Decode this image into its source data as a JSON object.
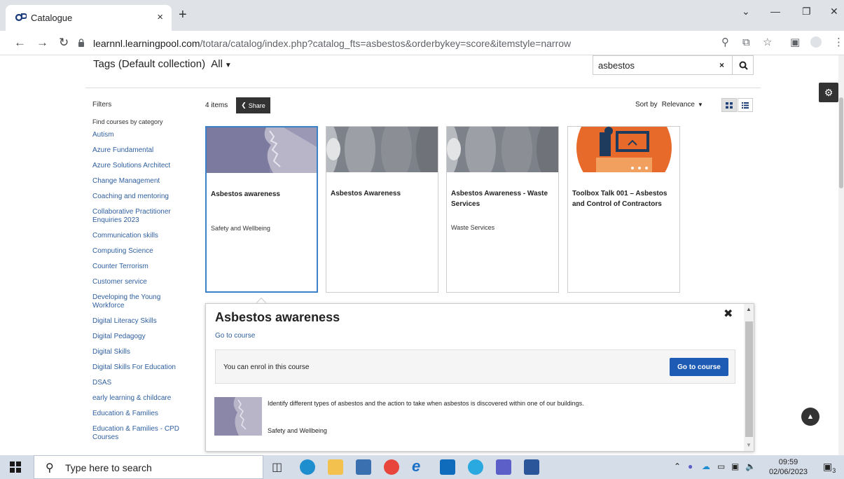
{
  "browser": {
    "tab_title": "Catalogue",
    "tab_close": "×",
    "new_tab": "+",
    "url_domain": "learnnl.learningpool.com",
    "url_path": "/totara/catalog/index.php?catalog_fts=asbestos&orderbykey=score&itemstyle=narrow"
  },
  "header": {
    "tags_label": "Tags (Default collection)",
    "tags_value": "All",
    "search_value": "asbestos",
    "search_clear": "×"
  },
  "filters": {
    "title": "Filters",
    "find_label": "Find courses by category",
    "categories": [
      "Autism",
      "Azure Fundamental",
      "Azure Solutions Architect",
      "Change Management",
      "Coaching and mentoring",
      "Collaborative Practitioner Enquiries 2023",
      "Communication skills",
      "Computing Science",
      "Counter Terrorism",
      "Customer service",
      "Developing the Young Workforce",
      "Digital Literacy Skills",
      "Digital Pedagogy",
      "Digital Skills",
      "Digital Skills For Education",
      "DSAS",
      "early learning & childcare",
      "Education & Families",
      "Education & Families - CPD Courses"
    ]
  },
  "results": {
    "count": "4 items",
    "share_label": "Share",
    "sort_label": "Sort by",
    "sort_value": "Relevance"
  },
  "cards": [
    {
      "name": "Asbestos awareness",
      "category": "Safety and Wellbeing"
    },
    {
      "name": "Asbestos Awareness",
      "category": ""
    },
    {
      "name": "Asbestos Awareness - Waste Services",
      "category": "Waste Services"
    },
    {
      "name": "Toolbox Talk 001 – Asbestos and Control of Contractors",
      "category": ""
    }
  ],
  "detail": {
    "title": "Asbestos awareness",
    "close": "✖",
    "go_to_link": "Go to course",
    "enrol_text": "You can enrol in this course",
    "enrol_button": "Go to course",
    "description": "Identify different types of asbestos and the action to take when asbestos is discovered within one of our buildings.",
    "category": "Safety and Wellbeing"
  },
  "taskbar": {
    "search_placeholder": "Type here to search",
    "time": "09:59",
    "date": "02/06/2023",
    "notifications": "3"
  },
  "colors": {
    "link": "#2f5f9e",
    "primary_button": "#1e5bb4",
    "selected_card_border": "#3c82c8",
    "dark_button": "#333333"
  }
}
